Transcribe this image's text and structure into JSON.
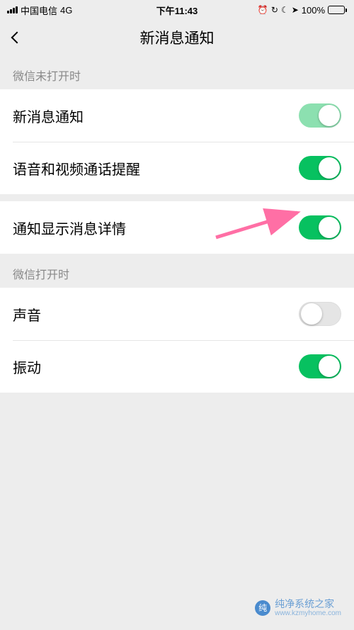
{
  "status": {
    "carrier": "中国电信",
    "network": "4G",
    "time": "下午11:43",
    "battery_pct": "100%"
  },
  "nav": {
    "title": "新消息通知"
  },
  "sections": [
    {
      "header": "微信未打开时",
      "rows": [
        {
          "label": "新消息通知",
          "state": "on-light"
        },
        {
          "label": "语音和视频通话提醒",
          "state": "on"
        }
      ]
    },
    {
      "header": null,
      "rows": [
        {
          "label": "通知显示消息详情",
          "state": "on"
        }
      ]
    },
    {
      "header": "微信打开时",
      "rows": [
        {
          "label": "声音",
          "state": "off"
        },
        {
          "label": "振动",
          "state": "on"
        }
      ]
    }
  ],
  "watermark": {
    "name": "纯净系统之家",
    "url": "www.kzmyhome.com"
  }
}
